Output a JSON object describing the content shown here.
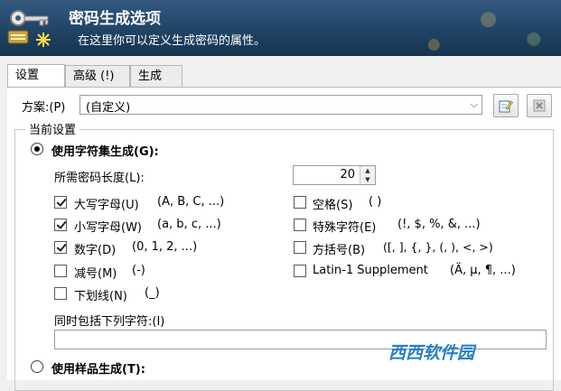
{
  "header": {
    "title": "密码生成选项",
    "subtitle": "在这里你可以定义生成密码的属性。"
  },
  "tabs": [
    {
      "label": "设置"
    },
    {
      "label": "高级 (!)"
    },
    {
      "label": "生成"
    }
  ],
  "scheme": {
    "label": "方案:(P)",
    "value": "(自定义)"
  },
  "current_settings": {
    "title": "当前设置",
    "charset_option": "使用字符集生成(G):",
    "length_label": "所需密码长度(L):",
    "length_value": "20",
    "options_left": [
      {
        "label": "大写字母(U)",
        "hint": "(A, B, C, ...)",
        "checked": true
      },
      {
        "label": "小写字母(W)",
        "hint": "(a, b, c, ...)",
        "checked": true
      },
      {
        "label": "数字(D)",
        "hint": "(0, 1, 2, ...)",
        "checked": true
      },
      {
        "label": "减号(M)",
        "hint": "(-)",
        "checked": false
      },
      {
        "label": "下划线(N)",
        "hint": "(_)",
        "checked": false
      }
    ],
    "options_right": [
      {
        "label": "空格(S)",
        "hint": "( )",
        "checked": false
      },
      {
        "label": "特殊字符(E)",
        "hint": "(!, $, %, &, ...)",
        "checked": false
      },
      {
        "label": "方括号(B)",
        "hint": "([, ], {, }, (, ), <, >)",
        "checked": false
      },
      {
        "label": "Latin-1 Supplement",
        "hint": "(Ä, µ, ¶, ...)",
        "checked": false
      }
    ],
    "also_include_label": "同时包括下列字符:(I)",
    "also_include_value": "",
    "sample_option": "使用样品生成(T):"
  },
  "watermark": "西西软件园",
  "colors": {
    "header_bg": "#1f4263",
    "panel_bg": "#ffffff",
    "brand_watermark": "#2a7fc1"
  }
}
